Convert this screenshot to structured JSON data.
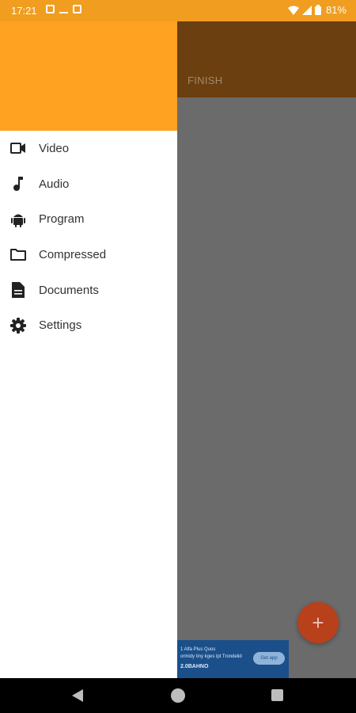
{
  "status_bar": {
    "time": "17:21",
    "battery": "81%",
    "icons": [
      "image-notif-icon",
      "download-notif-icon",
      "box-notif-icon",
      "wifi-icon",
      "signal-icon",
      "battery-icon"
    ]
  },
  "toolbar": {
    "finish_label": "FINISH"
  },
  "drawer": {
    "items": [
      {
        "label": "Video",
        "icon": "video-icon"
      },
      {
        "label": "Audio",
        "icon": "music-note-icon"
      },
      {
        "label": "Program",
        "icon": "android-icon"
      },
      {
        "label": "Compressed",
        "icon": "folder-icon"
      },
      {
        "label": "Documents",
        "icon": "document-icon"
      },
      {
        "label": "Settings",
        "icon": "gear-icon"
      }
    ]
  },
  "ad": {
    "line1": "1 Alfa Plus Quos",
    "line2": "ormidy tiny kges lpt Trondelid",
    "line3": "2.0BAHNO",
    "cta": "Get app"
  },
  "fab": {
    "symbol": "+"
  },
  "colors": {
    "status_bar": "#f09d20",
    "drawer_header": "#ffa121",
    "fab": "#b8401b"
  }
}
